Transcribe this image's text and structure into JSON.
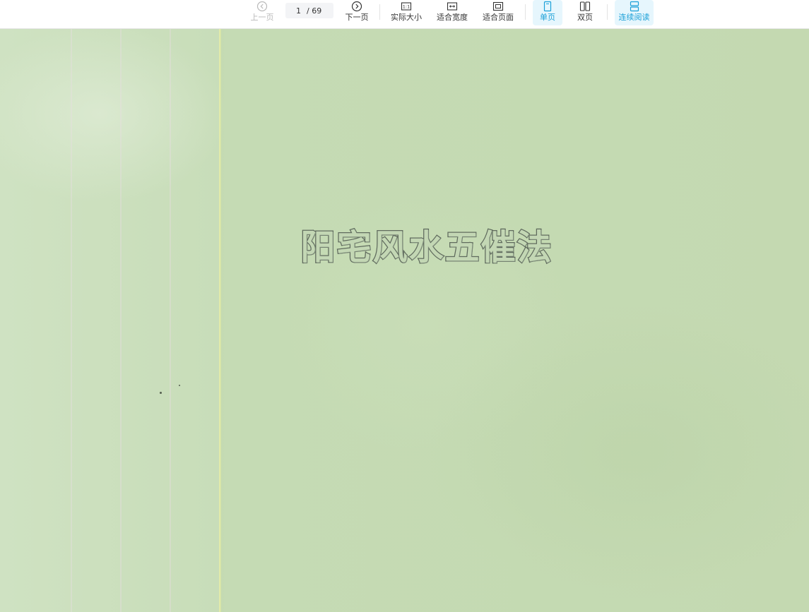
{
  "toolbar": {
    "prev_label": "上一页",
    "next_label": "下一页",
    "page_current": "1",
    "page_total": "/ 69",
    "actual_size_label": "实际大小",
    "fit_width_label": "适合宽度",
    "fit_page_label": "适合页面",
    "single_page_label": "单页",
    "double_page_label": "双页",
    "continuous_label": "连续阅读"
  },
  "document": {
    "cover_title": "阳宅风水五催法"
  },
  "colors": {
    "accent": "#1ba0d8",
    "active_bg": "#e6f6fd",
    "cover_green": "#c6dcb5"
  }
}
